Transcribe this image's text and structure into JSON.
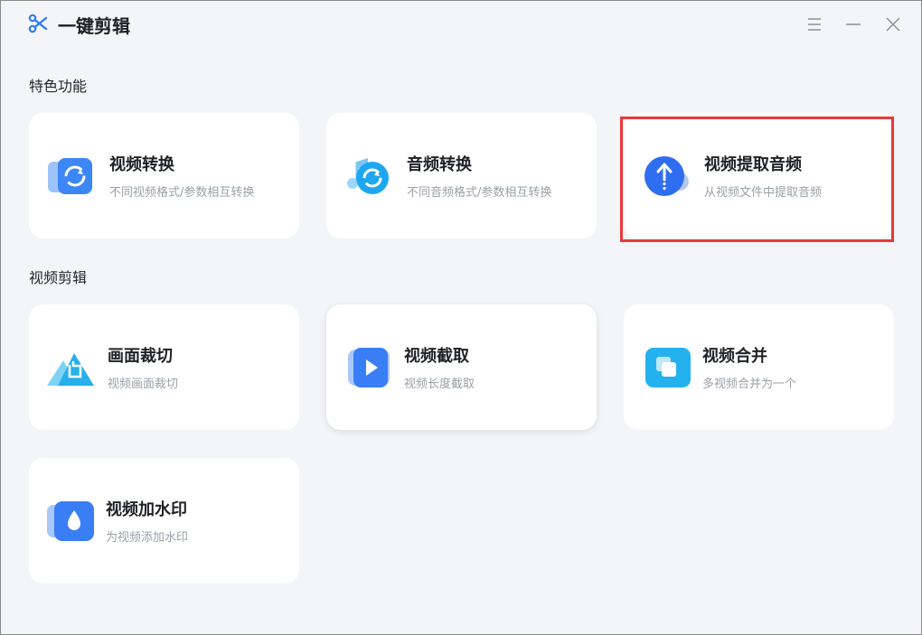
{
  "app": {
    "title": "一键剪辑"
  },
  "window_controls": [
    "menu-icon",
    "minimize-icon",
    "close-icon"
  ],
  "sections": [
    {
      "title": "特色功能",
      "cards": [
        {
          "title": "视频转换",
          "desc": "不同视频格式/参数相互转换",
          "icon": "video-convert-icon"
        },
        {
          "title": "音频转换",
          "desc": "不同音频格式/参数相互转换",
          "icon": "audio-convert-icon"
        },
        {
          "title": "视频提取音频",
          "desc": "从视频文件中提取音频",
          "icon": "extract-audio-icon"
        }
      ]
    },
    {
      "title": "视频剪辑",
      "cards": [
        {
          "title": "画面裁切",
          "desc": "视频画面裁切",
          "icon": "crop-icon"
        },
        {
          "title": "视频截取",
          "desc": "视频长度截取",
          "icon": "video-trim-icon"
        },
        {
          "title": "视频合并",
          "desc": "多视频合并为一个",
          "icon": "video-merge-icon"
        },
        {
          "title": "视频加水印",
          "desc": "为视频添加水印",
          "icon": "watermark-icon"
        }
      ]
    }
  ],
  "colors": {
    "accent": "#2f7bf5",
    "highlight": "#e8383a",
    "background": "#f4f5f8"
  }
}
